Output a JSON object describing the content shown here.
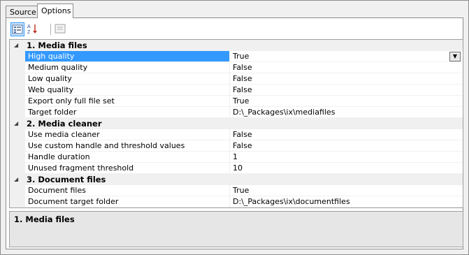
{
  "tabs": [
    {
      "label": "Source"
    },
    {
      "label": "Options"
    }
  ],
  "toolbar": {
    "icons": [
      "categorized-icon",
      "alphabetical-icon",
      "property-pages-icon"
    ]
  },
  "grid": {
    "categories": [
      {
        "label": "1. Media files",
        "rows": [
          {
            "name": "High quality",
            "value": "True"
          },
          {
            "name": "Medium quality",
            "value": "False"
          },
          {
            "name": "Low quality",
            "value": "False"
          },
          {
            "name": "Web quality",
            "value": "False"
          },
          {
            "name": "Export only full file set",
            "value": "True"
          },
          {
            "name": "Target folder",
            "value": "D:\\_Packages\\ix\\mediafiles"
          }
        ]
      },
      {
        "label": "2. Media cleaner",
        "rows": [
          {
            "name": "Use media cleaner",
            "value": "False"
          },
          {
            "name": "Use custom handle and threshold values",
            "value": "False"
          },
          {
            "name": "Handle duration",
            "value": "1"
          },
          {
            "name": "Unused fragment threshold",
            "value": "10"
          }
        ]
      },
      {
        "label": "3. Document files",
        "rows": [
          {
            "name": "Document files",
            "value": "True"
          },
          {
            "name": "Document target folder",
            "value": "D:\\_Packages\\ix\\documentfiles"
          }
        ]
      }
    ]
  },
  "description": {
    "title": "1. Media files"
  },
  "colors": {
    "selection": "#3399ff",
    "category_bg": "#f0f0f0"
  }
}
